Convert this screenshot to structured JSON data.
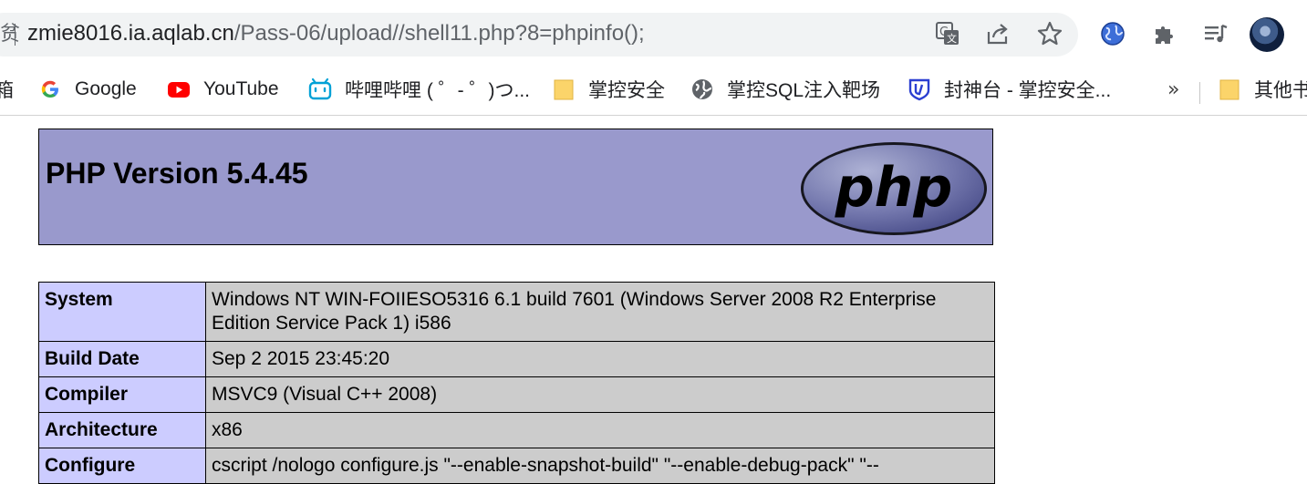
{
  "browser": {
    "url_host": "zmie8016.ia.aqlab.cn",
    "url_path": "/Pass-06/upload//shell11.php?8=phpinfo();",
    "omnibox_left_glyph": "贫",
    "toolbar_icons": [
      "translate-icon",
      "share-icon",
      "star-icon",
      "globe-extension-icon",
      "puzzle-icon",
      "media-queue-icon",
      "avatar"
    ]
  },
  "bookmarks": {
    "partial_left": "箱",
    "items": [
      {
        "label": "Google",
        "icon": "google-icon"
      },
      {
        "label": "YouTube",
        "icon": "youtube-icon"
      },
      {
        "label": "哔哩哔哩 ( ゜- ゜)つ...",
        "icon": "bilibili-icon"
      },
      {
        "label": "掌控安全",
        "icon": "folder-icon"
      },
      {
        "label": "掌控SQL注入靶场",
        "icon": "globe-icon"
      },
      {
        "label": "封神台 - 掌控安全...",
        "icon": "shield-icon"
      }
    ],
    "more": "»",
    "other": "其他书"
  },
  "phpinfo": {
    "title": "PHP Version 5.4.45",
    "logo_text": "php",
    "rows": [
      {
        "key": "System",
        "value": "Windows NT WIN-FOIIESO5316 6.1 build 7601 (Windows Server 2008 R2 Enterprise Edition Service Pack 1) i586"
      },
      {
        "key": "Build Date",
        "value": "Sep 2 2015 23:45:20"
      },
      {
        "key": "Compiler",
        "value": "MSVC9 (Visual C++ 2008)"
      },
      {
        "key": "Architecture",
        "value": "x86"
      },
      {
        "key": "Configure",
        "value": "cscript /nologo configure.js \"--enable-snapshot-build\" \"--enable-debug-pack\" \"--"
      }
    ]
  },
  "colors": {
    "header_bg": "#9999cc",
    "key_bg": "#ccccff",
    "value_bg": "#cccccc",
    "omnibox_bg": "#f1f3f4"
  }
}
